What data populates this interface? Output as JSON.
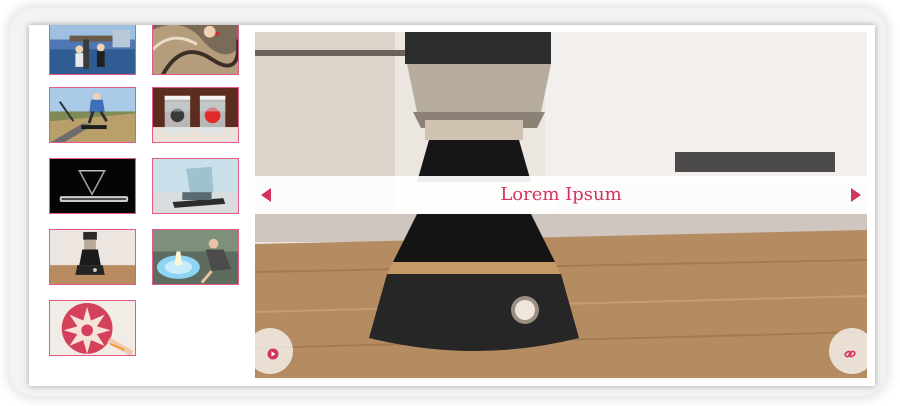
{
  "slider": {
    "caption": "Lorem Ipsum",
    "prev_icon": "chevron-left-icon",
    "next_icon": "chevron-right-icon",
    "play_icon": "play-icon",
    "link_icon": "link-icon"
  },
  "thumbnails": [
    {
      "subject": "people-on-dock"
    },
    {
      "subject": "hand-fabric-art"
    },
    {
      "subject": "skateboarder"
    },
    {
      "subject": "two-jars-liquid"
    },
    {
      "subject": "hologram-pyramid"
    },
    {
      "subject": "glass-phone-stand"
    },
    {
      "subject": "coffee-maker"
    },
    {
      "subject": "fire-water-fountain"
    },
    {
      "subject": "fruit-carving"
    }
  ],
  "colors": {
    "accent": "#d3335f",
    "thumb_border": "#e35c87"
  }
}
